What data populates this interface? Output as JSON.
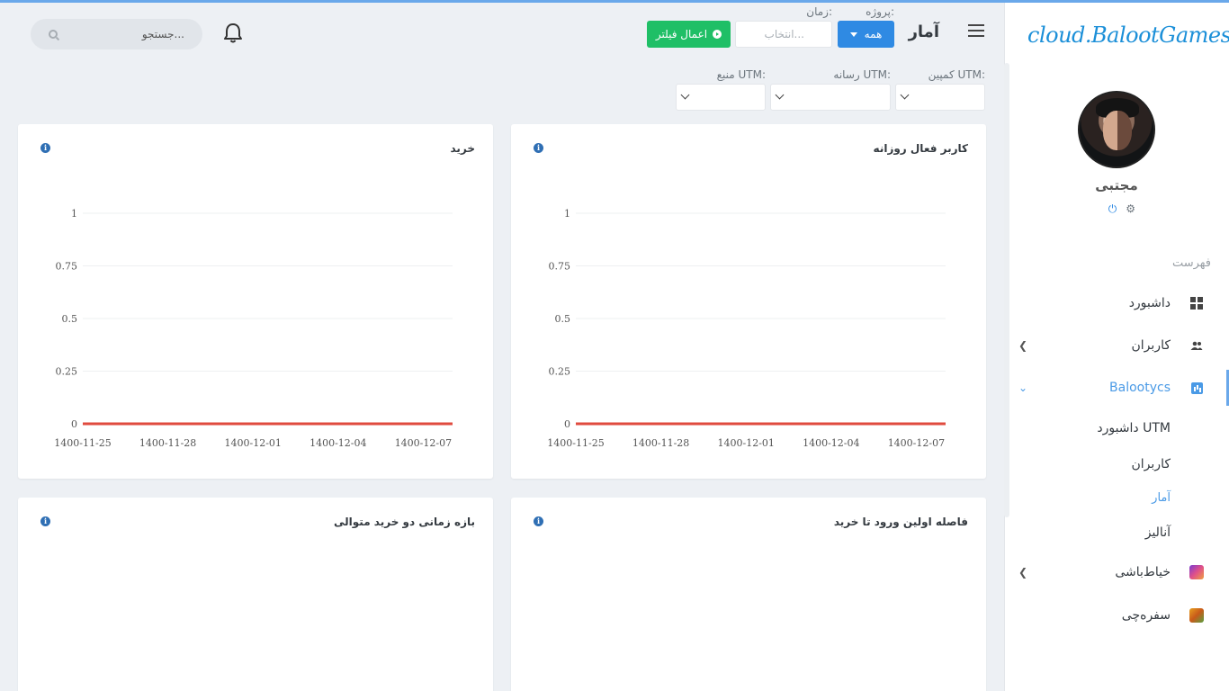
{
  "sidebar": {
    "logo": "cloud.BalootGames",
    "user_name": "مجتبی",
    "menu_title": "فهرست",
    "items": [
      {
        "label": "داشبورد",
        "icon": "dashboard-grid-icon"
      },
      {
        "label": "کاربران",
        "icon": "users-icon",
        "has_chevron": true
      },
      {
        "label": "Balootycs",
        "icon": "bar-chart-icon",
        "has_chevron": true,
        "active": true
      },
      {
        "label": "خیاط‌باشی",
        "icon": "game-khayatbashi-icon",
        "has_chevron": true
      },
      {
        "label": "سفره‌چی",
        "icon": "game-sofrechi-icon"
      }
    ],
    "sub_items": [
      {
        "label": "داشبورد UTM"
      },
      {
        "label": "کاربران"
      },
      {
        "label": "آمار",
        "active": true
      },
      {
        "label": "آنالیز"
      }
    ]
  },
  "header": {
    "title": "آمار",
    "project_label": "پروژه:",
    "project_value": "همه",
    "time_label": "زمان:",
    "time_placeholder": "انتخاب...",
    "apply_label": "اعمال فیلتر",
    "search_placeholder": "جستجو..."
  },
  "filters": {
    "utm_campaign_label": "کمپین UTM:",
    "utm_medium_label": "رسانه UTM:",
    "utm_source_label": "منبع UTM:"
  },
  "cards": [
    {
      "title": "کاربر فعال روزانه"
    },
    {
      "title": "خرید"
    },
    {
      "title": "فاصله اولین ورود تا خرید"
    },
    {
      "title": "بازه زمانی دو خرید متوالی"
    }
  ],
  "colors": {
    "accent": "#2f8ae3",
    "apply": "#1fbf66",
    "series_line": "#e04b3f"
  },
  "chart_data": [
    {
      "type": "line",
      "title": "کاربر فعال روزانه",
      "x": [
        "1400-11-25",
        "1400-11-28",
        "1400-12-01",
        "1400-12-04",
        "1400-12-07"
      ],
      "y_ticks": [
        "0",
        "0.25",
        "0.5",
        "0.75",
        "1"
      ],
      "ylim": [
        0,
        1
      ],
      "series": [
        {
          "values": [
            0,
            0,
            0,
            0,
            0
          ]
        }
      ],
      "grid": true
    },
    {
      "type": "line",
      "title": "خرید",
      "x": [
        "1400-11-25",
        "1400-11-28",
        "1400-12-01",
        "1400-12-04",
        "1400-12-07"
      ],
      "y_ticks": [
        "0",
        "0.25",
        "0.5",
        "0.75",
        "1"
      ],
      "ylim": [
        0,
        1
      ],
      "series": [
        {
          "values": [
            0,
            0,
            0,
            0,
            0
          ]
        }
      ],
      "grid": true
    }
  ]
}
